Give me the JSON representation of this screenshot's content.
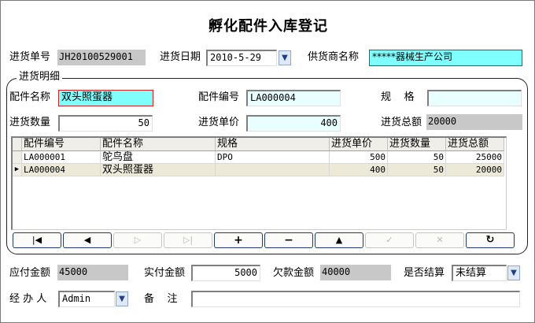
{
  "title": "孵化配件入库登记",
  "header": {
    "order_no_label": "进货单号",
    "order_no_value": "JH20100529001",
    "date_label": "进货日期",
    "date_value": "2010-5-29",
    "supplier_label": "供货商名称",
    "supplier_value": "*****器械生产公司"
  },
  "detail": {
    "group_title": "进货明细",
    "part_name_label": "配件名称",
    "part_name_value": "双头照蛋器",
    "part_code_label": "配件编号",
    "part_code_value": "LA000004",
    "spec_label": "规    格",
    "spec_value": "",
    "qty_label": "进货数量",
    "qty_value": "50",
    "price_label": "进货单价",
    "price_value": "400",
    "total_label": "进货总额",
    "total_value": "20000"
  },
  "grid": {
    "columns": [
      "配件编号",
      "配件名称",
      "规格",
      "进货单价",
      "进货数量",
      "进货总额"
    ],
    "rows": [
      {
        "code": "LA000001",
        "name": "鸵鸟盘",
        "spec": "DPO",
        "price": "500",
        "qty": "50",
        "total": "25000",
        "current": false
      },
      {
        "code": "LA000004",
        "name": "双头照蛋器",
        "spec": "",
        "price": "400",
        "qty": "50",
        "total": "20000",
        "current": true
      }
    ]
  },
  "nav": {
    "first": "|◀",
    "prev": "◀",
    "next": "▷",
    "last": "▷|",
    "add": "+",
    "delete": "−",
    "edit": "▲",
    "post": "✓",
    "cancel": "✕",
    "refresh": "↻"
  },
  "footer": {
    "payable_label": "应付金额",
    "payable_value": "45000",
    "paid_label": "实付金额",
    "paid_value": "5000",
    "owed_label": "欠款金额",
    "owed_value": "40000",
    "settled_label": "是否结算",
    "settled_value": "未结算",
    "handler_label": "经 办 人",
    "handler_value": "Admin",
    "remark_label": "备    注",
    "remark_value": ""
  },
  "colors": {
    "highlight_cyan": "#80ffff",
    "light_cyan": "#e9ffff",
    "readonly_gray": "#c8c8c8",
    "required_border": "#d02020"
  }
}
